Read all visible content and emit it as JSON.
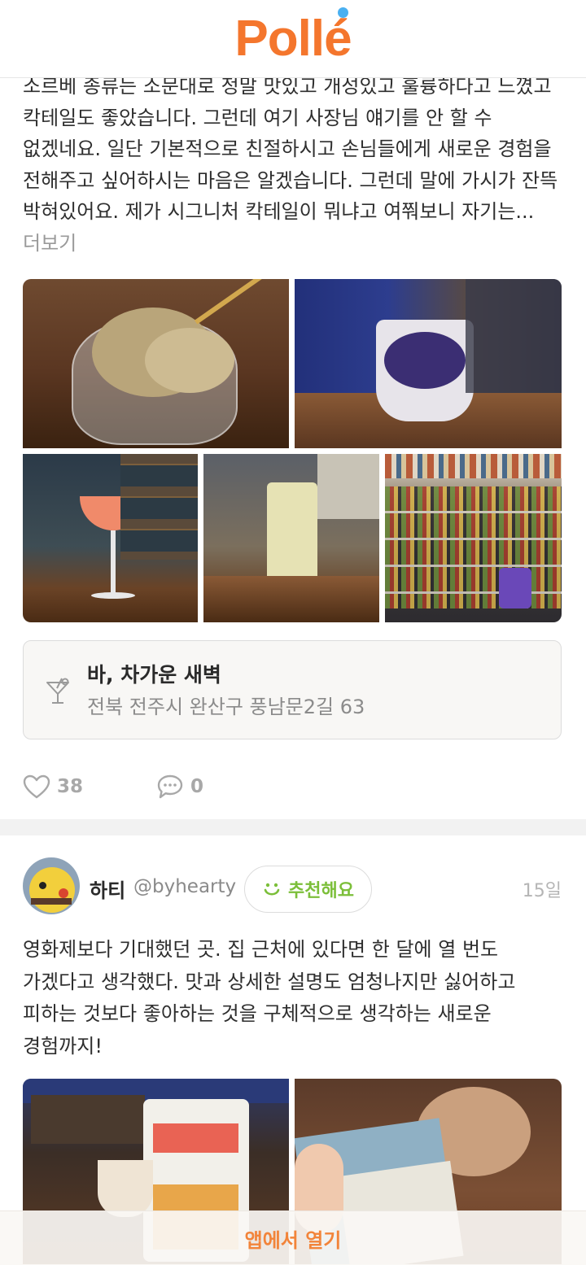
{
  "app": {
    "logo_text": "Pollé",
    "brand_color": "#f4762d",
    "logo_dot_color": "#4ab0f1"
  },
  "review1": {
    "text": "소르베 종류는 소문대로 정말 맛있고 개성있고 훌륭하다고 느꼈고 칵테일도 좋았습니다. 그런데 여기 사장님 얘기를 안 할 수 없겠네요. 일단 기본적으로 친절하시고 손님들에게 새로운 경험을 전해주고 싶어하시는 마음은 알겠습니다. 그런데 말에 가시가 잔뜩 박혀있어요. 제가 시그니처 칵테일이 뭐냐고 여쭤보니 자기는...",
    "more_label": "더보기",
    "photos": [
      "ice-cream-photo",
      "cup-sorbet-photo",
      "cocktail-photo",
      "highball-photo",
      "bar-shelf-photo"
    ],
    "place": {
      "icon": "cocktail-glass-icon",
      "name": "바, 차가운 새벽",
      "address": "전북 전주시 완산구 풍남문2길 63"
    },
    "likes": "38",
    "comments": "0"
  },
  "review2": {
    "user_name": "하티",
    "user_handle": "@byhearty",
    "badge_label": "추천해요",
    "badge_icon": "smile-icon",
    "date": "15일",
    "text": "영화제보다 기대했던 곳. 집 근처에 있다면 한 달에 열 번도 가겠다고 생각했다. 맛과 상세한 설명도 엄청나지만 싫어하고 피하는 것보다 좋아하는 것을 구체적으로 생각하는 새로운 경험까지!",
    "photos": [
      "snack-bag-photo",
      "memo-card-photo"
    ]
  },
  "footer": {
    "open_app_label": "앱에서 열기"
  }
}
